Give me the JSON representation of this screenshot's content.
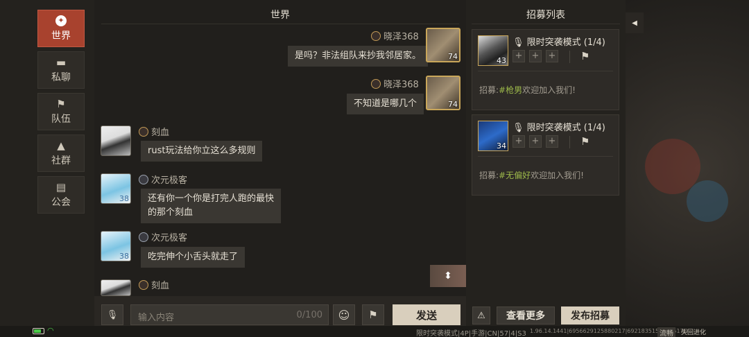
{
  "nav": [
    {
      "label": "世界",
      "icon": "globe-icon",
      "active": true
    },
    {
      "label": "私聊",
      "icon": "speech-bubble-icon",
      "active": false
    },
    {
      "label": "队伍",
      "icon": "flag-icon",
      "active": false
    },
    {
      "label": "社群",
      "icon": "campfire-icon",
      "active": false
    },
    {
      "label": "公会",
      "icon": "banner-icon",
      "active": false
    }
  ],
  "world": {
    "title": "世界",
    "messages": [
      {
        "name": "晓泽368",
        "text": "是吗？非法组队来抄我邻居家。",
        "level": "74",
        "side": "right"
      },
      {
        "name": "晓泽368",
        "text": "不知道是哪几个",
        "level": "74",
        "side": "right"
      },
      {
        "name": "刻血",
        "text": "rust玩法给你立这么多规则",
        "level": "",
        "side": "left"
      },
      {
        "name": "次元极客",
        "text": "还有你一个你是打完人跑的最快",
        "text2": "的那个刻血",
        "level": "38",
        "side": "left"
      },
      {
        "name": "次元极客",
        "text": "吃完伸个小舌头就走了",
        "level": "38",
        "side": "left"
      },
      {
        "name": "刻血",
        "text": "",
        "level": "",
        "side": "left"
      }
    ]
  },
  "input": {
    "placeholder": "输入内容",
    "counter": "0/100",
    "send_label": "发送"
  },
  "recruit": {
    "title": "招募列表",
    "cards": [
      {
        "mode": "限时突袭模式 (1/4)",
        "level": "43",
        "prefix": "招募:",
        "tag": "#枪男",
        "suffix": "欢迎加入我们!"
      },
      {
        "mode": "限时突袭模式 (1/4)",
        "level": "34",
        "prefix": "招募:",
        "tag": "#无偏好",
        "suffix": "欢迎加入我们!"
      }
    ],
    "more_label": "查看更多",
    "publish_label": "发布招募",
    "slot_symbol": "+"
  },
  "status": {
    "info": "限时突袭模式|4P|手游|CN|57|4|S3",
    "id": "1.96.14.1441|6956629125880217|6921835155213517O",
    "net": "流畅",
    "logo": "失回进化"
  },
  "colors": {
    "accent": "#a8422e",
    "highlight": "#9cb84a",
    "battery": "#4cc94a"
  }
}
